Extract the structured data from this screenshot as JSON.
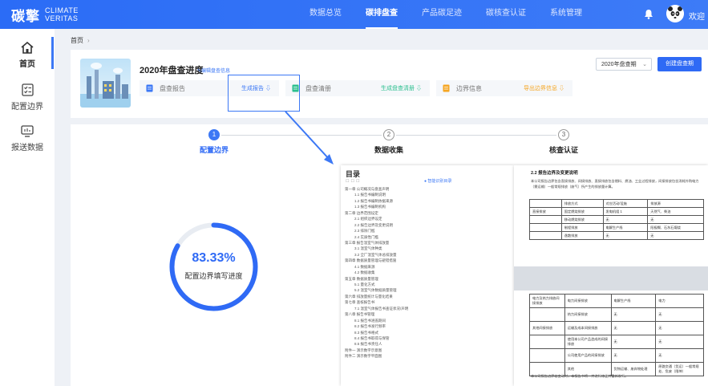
{
  "header": {
    "logo_cn": "碳擎",
    "logo_en_line1": "CLIMATE",
    "logo_en_line2": "VERITAS",
    "nav": [
      "数据总览",
      "碳排盘查",
      "产品碳足迹",
      "碳核查认证",
      "系统管理"
    ],
    "active_nav": "碳排盘查",
    "welcome": "欢迎"
  },
  "sidebar": {
    "items": [
      {
        "label": "首页",
        "icon": "home-icon"
      },
      {
        "label": "配置边界",
        "icon": "checklist-icon"
      },
      {
        "label": "报送数据",
        "icon": "monitor-icon"
      }
    ]
  },
  "breadcrumb": {
    "home": "首页",
    "sep": "›"
  },
  "inventory": {
    "title": "2020年盘查进度",
    "edit_label": "编辑盘查信息",
    "period_select": "2020年盘查期",
    "create_button": "创建盘查期",
    "tiles": [
      {
        "label": "盘查报告",
        "action": "生成报告"
      },
      {
        "label": "盘查清册",
        "action": "生成盘查清册"
      },
      {
        "label": "边界信息",
        "action": "导出边界信息"
      }
    ]
  },
  "steps": [
    {
      "num": "1",
      "label": "配置边界"
    },
    {
      "num": "2",
      "label": "数据收集"
    },
    {
      "num": "3",
      "label": "核查认证"
    }
  ],
  "progress": {
    "value_text": "83.33%",
    "fraction": 0.8333,
    "label": "配置边界填写进度"
  },
  "doc_toc": {
    "title": "目录",
    "button": "智能识别目录",
    "rows": [
      {
        "level": 1,
        "text": "第一章 公司概况与盘查声明"
      },
      {
        "level": 2,
        "text": "1.1 报告书编制说明"
      },
      {
        "level": 2,
        "text": "1.2 报告书编制依据来源"
      },
      {
        "level": 2,
        "text": "1.3 报告书编制机构"
      },
      {
        "level": 1,
        "text": "第二章 边界范围设定"
      },
      {
        "level": 2,
        "text": "2.1 组织边界设定"
      },
      {
        "level": 2,
        "text": "2.2 报告边界及变更说明"
      },
      {
        "level": 2,
        "text": "2.3 排除门槛"
      },
      {
        "level": 2,
        "text": "2.4 实质性门槛"
      },
      {
        "level": 1,
        "text": "第三章 报告温室气体排放量"
      },
      {
        "level": 2,
        "text": "3.1 温室气体种类"
      },
      {
        "level": 2,
        "text": "3.2 全厂温室气体总排放量"
      },
      {
        "level": 1,
        "text": "第四章 数据质量管理与避错措施"
      },
      {
        "level": 2,
        "text": "4.1 数据来源"
      },
      {
        "level": 2,
        "text": "4.2 数据收集"
      },
      {
        "level": 1,
        "text": "第五章 数据质量管理"
      },
      {
        "level": 2,
        "text": "5.1 量化方式"
      },
      {
        "level": 2,
        "text": "5.2 温室气体数据质量管理"
      },
      {
        "level": 1,
        "text": "第六章 排放量统计与量化结果"
      },
      {
        "level": 1,
        "text": "第七章 查核报告书"
      },
      {
        "level": 2,
        "text": "7.1 温室气体报告书查证状况/声明"
      },
      {
        "level": 1,
        "text": "第八章 报告书管理"
      },
      {
        "level": 2,
        "text": "8.1 报告书涵盖期间"
      },
      {
        "level": 2,
        "text": "8.2 报告书发行频率"
      },
      {
        "level": 2,
        "text": "8.3 报告书格式"
      },
      {
        "level": 2,
        "text": "8.4 报告书取得与保管"
      },
      {
        "level": 2,
        "text": "8.5 报告书责任人"
      },
      {
        "level": 1,
        "text": "附件一 演示数字示意图"
      },
      {
        "level": 1,
        "text": "附件二 演示数字平面图"
      }
    ]
  },
  "doc_page": {
    "section_title": "2.2 报告边界及变更说明",
    "para1": "本公司报告边界包含直接排放、间接排放、直接排放包含燃料、燃油、工业过程排放，间接排放包含消耗外购电力（需运输）一般常规排放（废气）所产生的排放量计算。",
    "table1": [
      [
        "",
        "排放方式",
        "对应活动/设施",
        "排放源"
      ],
      [
        "直接排放",
        "固定燃烧排放",
        "发电机组 1",
        "天然气、柴油"
      ],
      [
        "",
        "移动燃烧排放",
        "无",
        "无"
      ],
      [
        "",
        "制程排放",
        "电解生产线",
        "阳极糊、石灰石煅烧"
      ],
      [
        "",
        "逸散排放",
        "无",
        "无"
      ]
    ],
    "table2": [
      [
        "电力及热力排放间接排放",
        "电力间接排放",
        "电解生产线",
        "电力"
      ],
      [
        "",
        "热力间接排放",
        "无",
        "无"
      ],
      [
        "其他间接排放",
        "运输及成本间接排放",
        "无",
        "无"
      ],
      [
        "",
        "使用本公司产品造成的间接排放",
        "无",
        "无"
      ],
      [
        "",
        "公司使用产品的间接排放",
        "无",
        "无"
      ],
      [
        "",
        "其他",
        "货物运输、废弃物处理",
        "原路交通（货运）一般常规处、危废（限坤）"
      ]
    ],
    "footnote": "本公司报告边界若变动时，本报告书将一并进行修正并重新发行。"
  }
}
